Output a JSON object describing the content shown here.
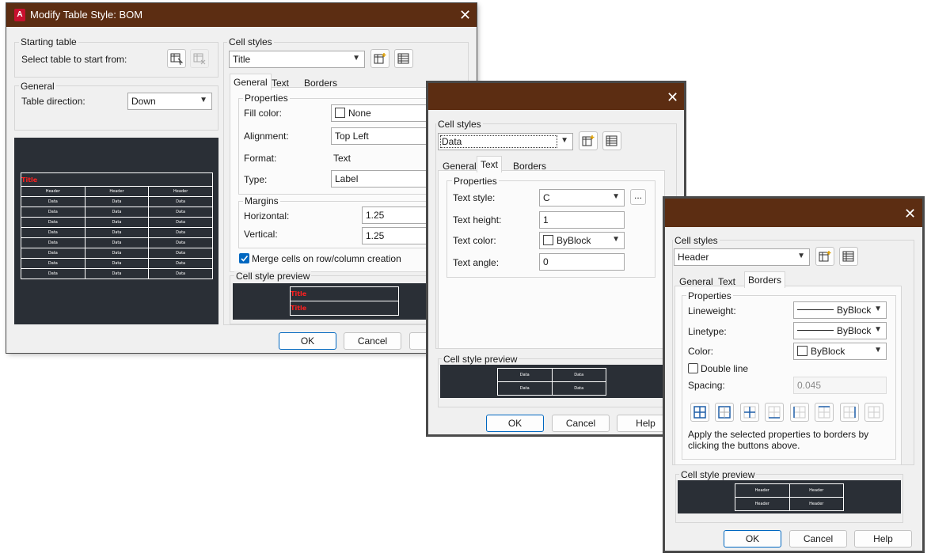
{
  "main": {
    "title": "Modify Table Style: BOM",
    "starting_table": {
      "label": "Starting table",
      "select_label": "Select table to start from:"
    },
    "general": {
      "label": "General",
      "direction_label": "Table direction:",
      "direction_value": "Down"
    },
    "preview_table": {
      "title": "Title",
      "headers": [
        "Header",
        "Header",
        "Header"
      ],
      "rows": [
        [
          "Data",
          "Data",
          "Data"
        ],
        [
          "Data",
          "Data",
          "Data"
        ],
        [
          "Data",
          "Data",
          "Data"
        ],
        [
          "Data",
          "Data",
          "Data"
        ],
        [
          "Data",
          "Data",
          "Data"
        ],
        [
          "Data",
          "Data",
          "Data"
        ],
        [
          "Data",
          "Data",
          "Data"
        ],
        [
          "Data",
          "Data",
          "Data"
        ]
      ]
    },
    "cell_styles": {
      "label": "Cell styles",
      "value": "Title"
    },
    "tabs": [
      "General",
      "Text",
      "Borders"
    ],
    "properties": {
      "label": "Properties",
      "fill_color_label": "Fill color:",
      "fill_color_value": "None",
      "alignment_label": "Alignment:",
      "alignment_value": "Top Left",
      "format_label": "Format:",
      "format_value": "Text",
      "type_label": "Type:",
      "type_value": "Label"
    },
    "margins": {
      "label": "Margins",
      "horizontal_label": "Horizontal:",
      "horizontal_value": "1.25",
      "vertical_label": "Vertical:",
      "vertical_value": "1.25"
    },
    "merge_label": "Merge cells on row/column creation",
    "cell_preview_label": "Cell style preview",
    "cell_preview_rows": [
      "Title",
      "Title"
    ],
    "ok_label": "OK",
    "cancel_label": "Cancel"
  },
  "text_dialog": {
    "cell_styles": {
      "label": "Cell styles",
      "value": "Data"
    },
    "tabs": [
      "General",
      "Text",
      "Borders"
    ],
    "properties": {
      "label": "Properties",
      "text_style_label": "Text style:",
      "text_style_value": "C",
      "browse_label": "...",
      "text_height_label": "Text height:",
      "text_height_value": "1",
      "text_color_label": "Text color:",
      "text_color_value": "ByBlock",
      "text_angle_label": "Text angle:",
      "text_angle_value": "0"
    },
    "cell_preview_label": "Cell style preview",
    "cell_preview_cells": [
      "Data",
      "Data",
      "Data",
      "Data"
    ],
    "ok_label": "OK",
    "cancel_label": "Cancel",
    "help_label": "Help"
  },
  "borders_dialog": {
    "cell_styles": {
      "label": "Cell styles",
      "value": "Header"
    },
    "tabs": [
      "General",
      "Text",
      "Borders"
    ],
    "properties": {
      "label": "Properties",
      "lineweight_label": "Lineweight:",
      "lineweight_value": "ByBlock",
      "linetype_label": "Linetype:",
      "linetype_value": "ByBlock",
      "color_label": "Color:",
      "color_value": "ByBlock",
      "double_line_label": "Double line",
      "spacing_label": "Spacing:",
      "spacing_value": "0.045",
      "apply_text": "Apply the selected properties to borders by clicking the buttons above."
    },
    "cell_preview_label": "Cell style preview",
    "cell_preview_cells": [
      "Header",
      "Header",
      "Header",
      "Header"
    ],
    "ok_label": "OK",
    "cancel_label": "Cancel",
    "help_label": "Help"
  },
  "colors": {
    "titlebar": "#5c2d12",
    "preview_bg": "#2a2f36",
    "title_text_red": "#ff2020",
    "accent": "#0067c0"
  }
}
